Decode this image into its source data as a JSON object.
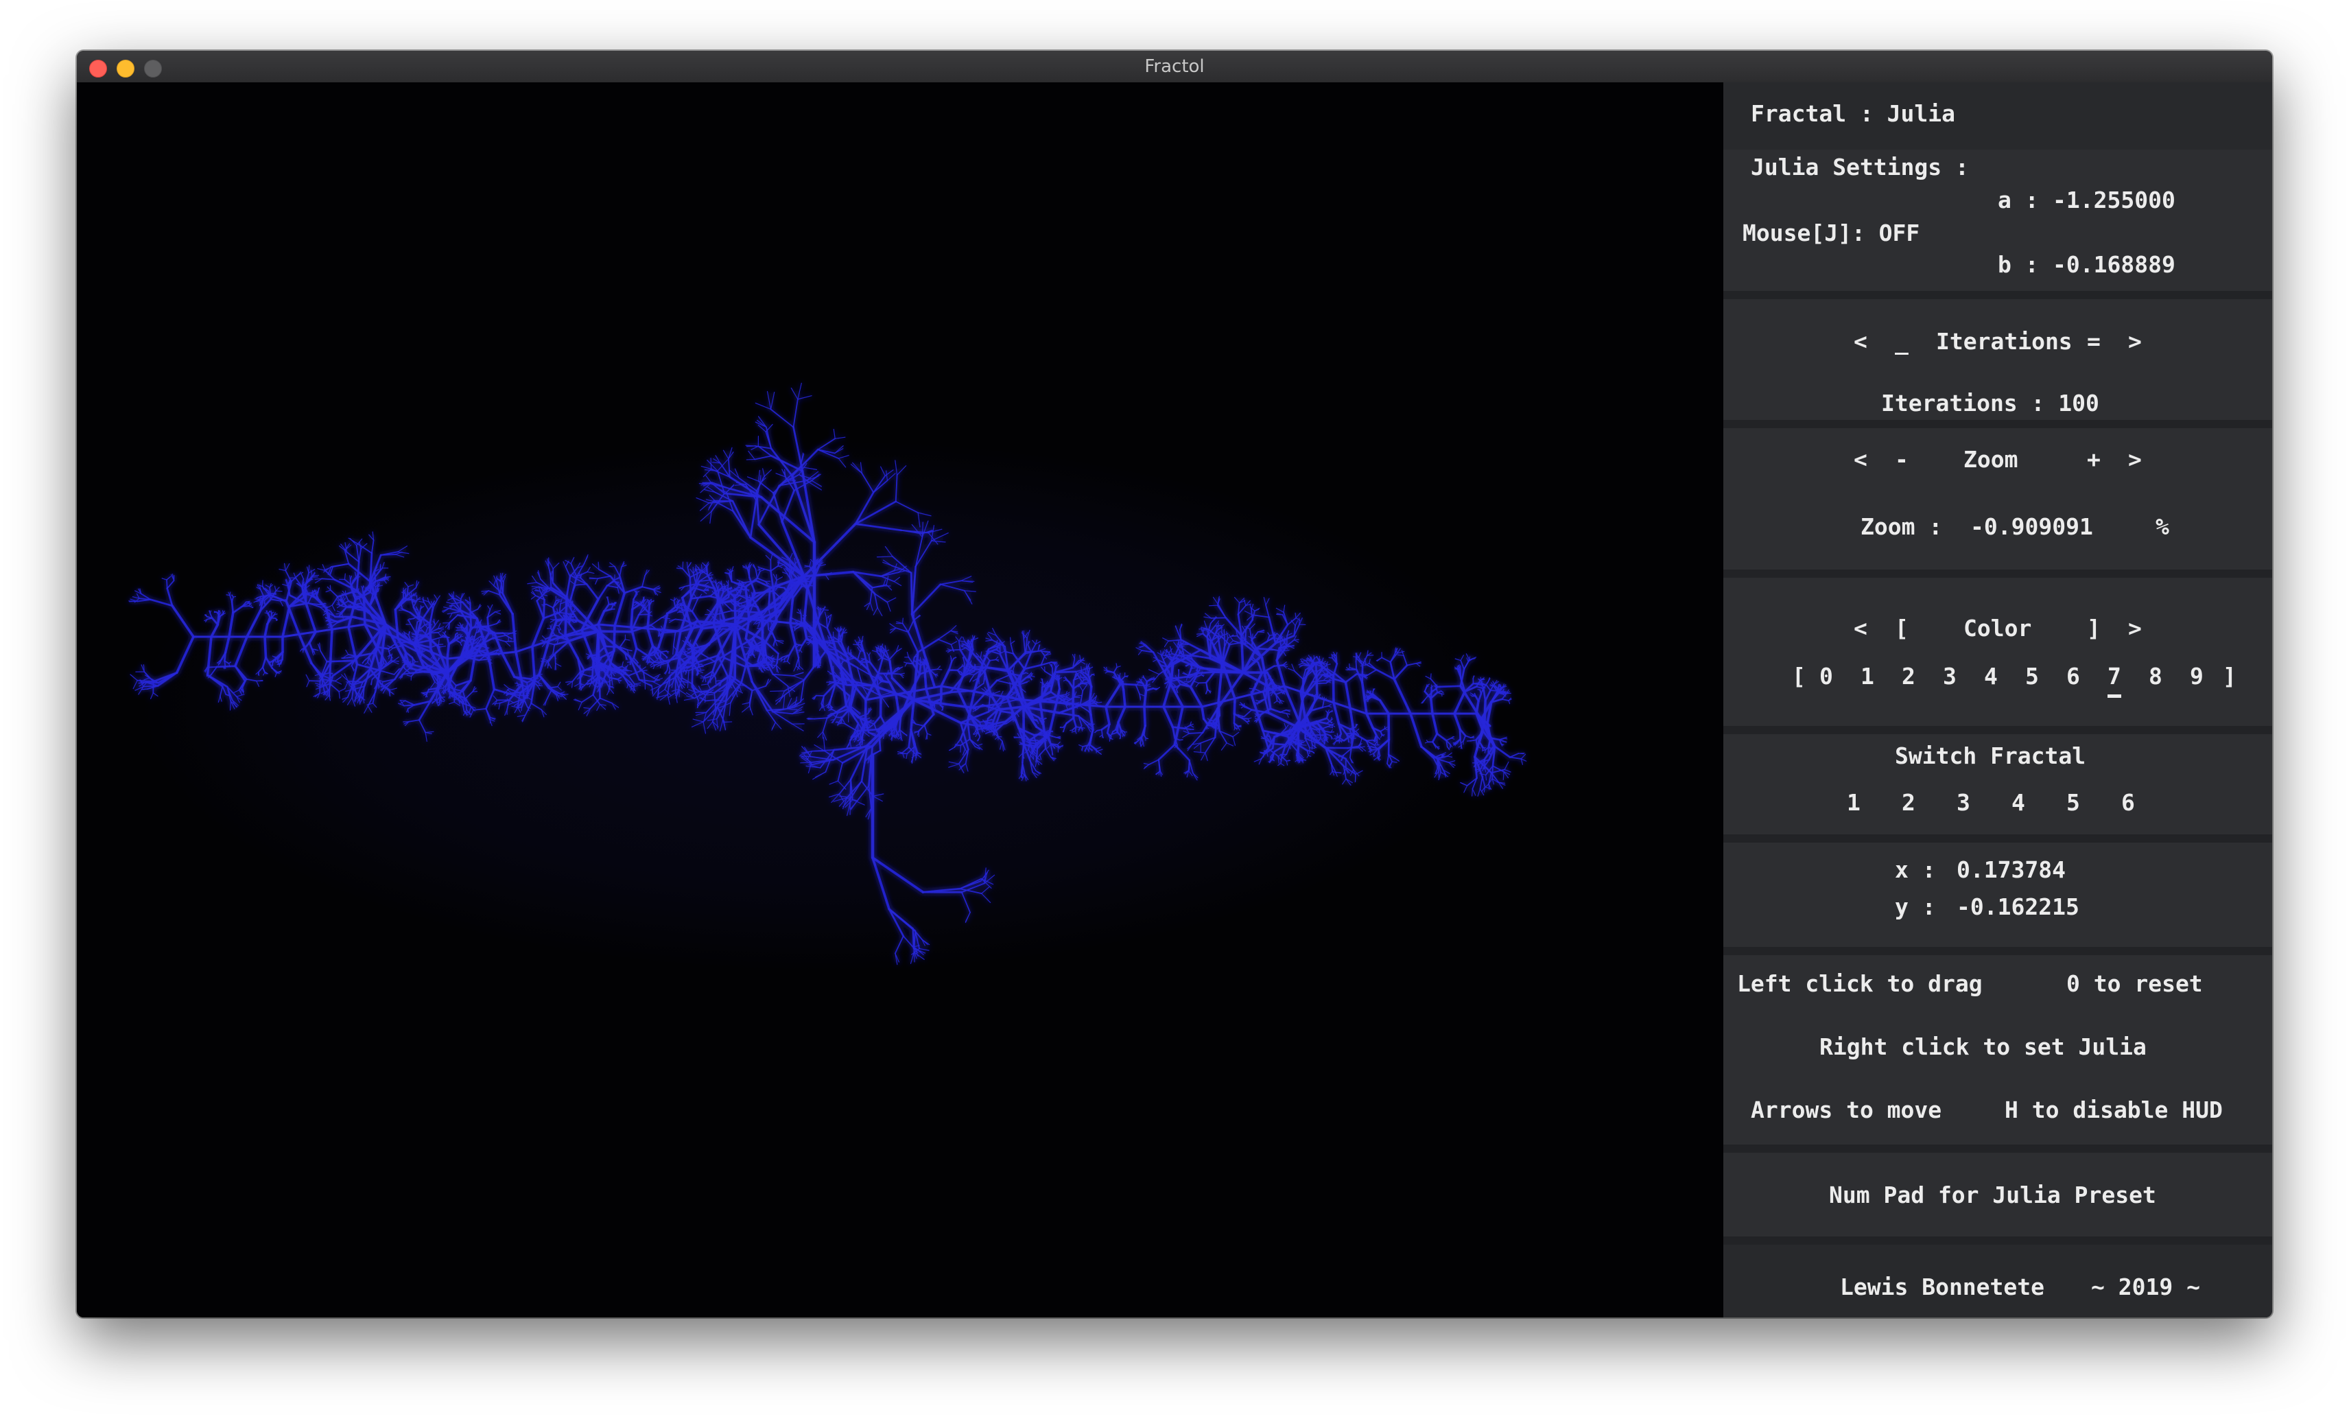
{
  "window": {
    "title": "Fractol"
  },
  "hud": {
    "fractal_label": "Fractal : Julia",
    "julia": {
      "heading": "Julia Settings :",
      "a_label": "a :",
      "a_value": "-1.255000",
      "mouse": "Mouse[J]: OFF",
      "b_label": "b :",
      "b_value": "-0.168889"
    },
    "iterations": {
      "left": "<",
      "minus": "_",
      "label": "Iterations",
      "plus": "=",
      "right": ">",
      "value_text": "Iterations : 100"
    },
    "zoom": {
      "left": "<",
      "minus": "-",
      "label": "Zoom",
      "plus": "+",
      "right": ">",
      "value_label": "Zoom :",
      "value": "-0.909091",
      "unit": "%"
    },
    "color": {
      "left": "<",
      "open": "[",
      "label": "Color",
      "close": "]",
      "right": ">",
      "bracket_open": "[",
      "bracket_close": "]",
      "options": [
        "0",
        "1",
        "2",
        "3",
        "4",
        "5",
        "6",
        "7",
        "8",
        "9"
      ],
      "selected": "7"
    },
    "switch_fractal": {
      "label": "Switch Fractal",
      "options": [
        "1",
        "2",
        "3",
        "4",
        "5",
        "6"
      ]
    },
    "coords": {
      "x_label": "x :",
      "x_value": "0.173784",
      "y_label": "y :",
      "y_value": "-0.162215"
    },
    "help": {
      "drag": "Left click to drag",
      "reset": "0 to reset",
      "set_julia": "Right click to set Julia",
      "move": "Arrows to move",
      "hud": "H to disable HUD",
      "numpad": "Num Pad for Julia Preset"
    },
    "credits": {
      "author": "Lewis Bonnetete",
      "year": "~ 2019 ~"
    }
  },
  "colors": {
    "fractal": "#2626d9",
    "background": "#020204",
    "hud_bg": "#2d2e31"
  }
}
